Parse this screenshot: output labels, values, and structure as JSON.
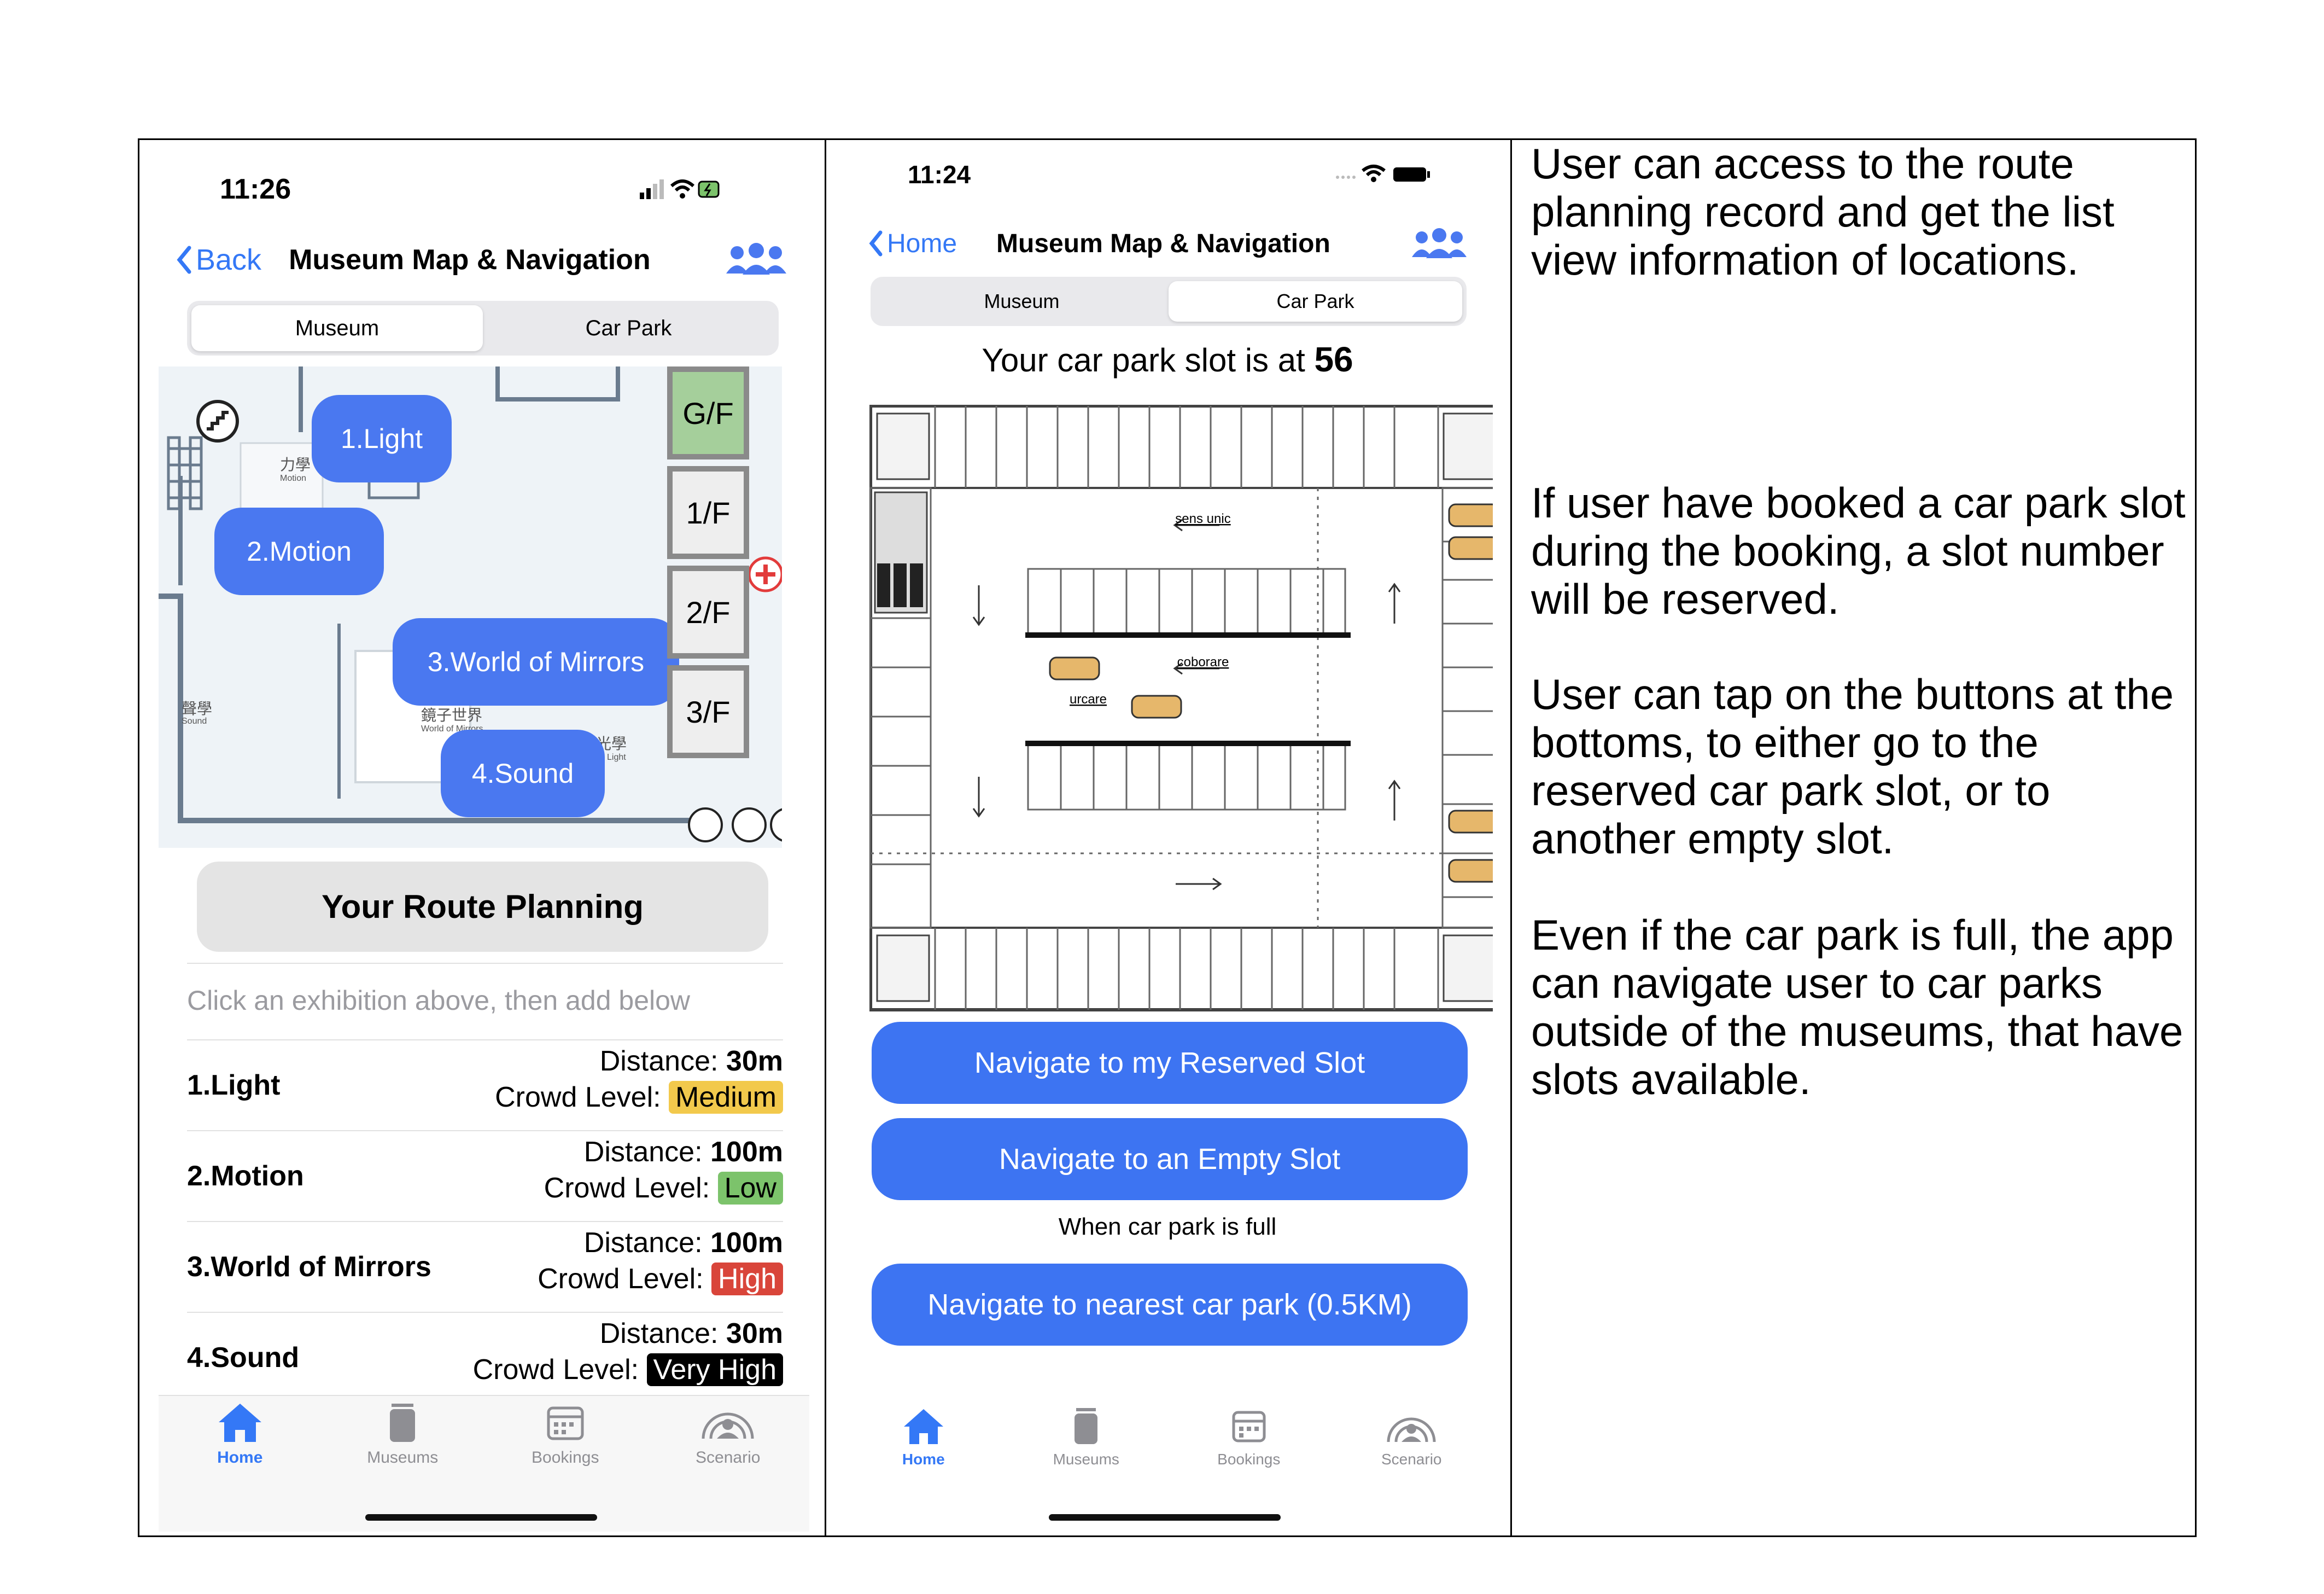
{
  "panel1": {
    "time": "11:26",
    "back_label": "Back",
    "title": "Museum Map & Navigation",
    "segments": [
      "Museum",
      "Car Park"
    ],
    "map": {
      "pins": [
        "1.Light",
        "2.Motion",
        "3.World of Mirrors",
        "4.Sound"
      ],
      "floors": [
        "G/F",
        "1/F",
        "2/F",
        "3/F"
      ],
      "labels": {
        "motion_cn": "力學",
        "motion_en": "Motion",
        "sound_cn": "聲學",
        "sound_en": "Sound",
        "mirrors_cn": "鏡子世界",
        "mirrors_en": "World of Mirrors",
        "light_cn": "光學",
        "light_en": "Light"
      }
    },
    "route_button": "Your Route Planning",
    "hint": "Click an exhibition above, then add below",
    "distance_label": "Distance:",
    "crowd_label": "Crowd Level:",
    "exhibitions": [
      {
        "name": "1.Light",
        "distance": "30m",
        "crowd": "Medium",
        "crowd_color": "#f2c94c",
        "crowd_text_color": "#000000"
      },
      {
        "name": "2.Motion",
        "distance": "100m",
        "crowd": "Low",
        "crowd_color": "#7cc36b",
        "crowd_text_color": "#000000"
      },
      {
        "name": "3.World of Mirrors",
        "distance": "100m",
        "crowd": "High",
        "crowd_color": "#d9453a",
        "crowd_text_color": "#ffffff"
      },
      {
        "name": "4.Sound",
        "distance": "30m",
        "crowd": "Very High",
        "crowd_color": "#000000",
        "crowd_text_color": "#ffffff"
      }
    ],
    "tabs": [
      "Home",
      "Museums",
      "Bookings",
      "Scenario"
    ]
  },
  "panel2": {
    "time": "11:24",
    "back_label": "Home",
    "title": "Museum Map & Navigation",
    "segments": [
      "Museum",
      "Car Park"
    ],
    "slot_prefix": "Your car park slot is at ",
    "slot_number": "56",
    "plan_labels": [
      "sens unic",
      "coborare",
      "urcare"
    ],
    "btn_reserved": "Navigate to my Reserved Slot",
    "btn_empty": "Navigate to an Empty Slot",
    "full_note": "When car park is full",
    "btn_nearest": "Navigate to nearest car park (0.5KM)",
    "tabs": [
      "Home",
      "Museums",
      "Bookings",
      "Scenario"
    ]
  },
  "descriptions": {
    "p1": "User can access to the route planning record and get the list view information of locations.",
    "p2": "If user have booked a car park slot during the booking, a slot number will be reserved.",
    "p3": "User can tap on the buttons at the bottoms, to either go to the reserved car park slot, or to another empty slot.",
    "p4": "Even if the car park is full, the app can navigate user to car parks outside of the museums, that have slots available."
  },
  "colors": {
    "accent": "#3d74f2",
    "pin": "#4a78f0",
    "tab_active": "#3478f6"
  },
  "icons": [
    "back-chevron-icon",
    "group-icon",
    "signal-icon",
    "wifi-icon",
    "battery-icon",
    "home-icon",
    "museums-icon",
    "bookings-icon",
    "scenario-icon"
  ]
}
